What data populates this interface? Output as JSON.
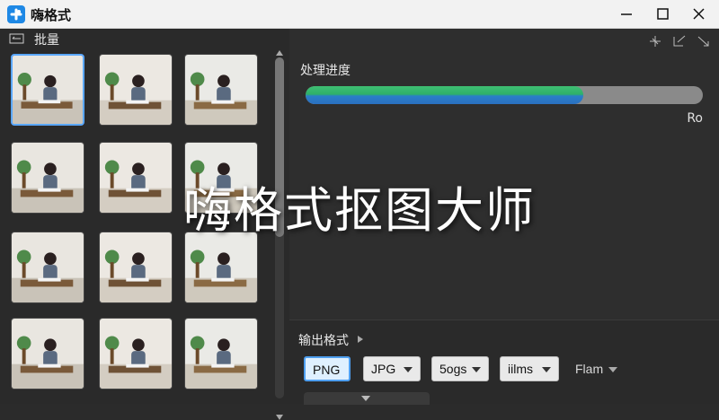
{
  "window": {
    "title": "嗨格式"
  },
  "left": {
    "batch_label": "批量"
  },
  "thumbnails": [
    {
      "name": "photo-1",
      "selected": true
    },
    {
      "name": "photo-2",
      "selected": false
    },
    {
      "name": "photo-3",
      "selected": false
    },
    {
      "name": "photo-4",
      "selected": false
    },
    {
      "name": "photo-5",
      "selected": false
    },
    {
      "name": "photo-6",
      "selected": false
    },
    {
      "name": "photo-7",
      "selected": false
    },
    {
      "name": "photo-8",
      "selected": false
    },
    {
      "name": "photo-9",
      "selected": false
    },
    {
      "name": "photo-10",
      "selected": false
    },
    {
      "name": "photo-11",
      "selected": false
    },
    {
      "name": "photo-12",
      "selected": false
    }
  ],
  "progress": {
    "label": "处理进度",
    "value_text": "Ro",
    "fraction": 0.7,
    "colors": {
      "top": "#3fbf73",
      "bottom": "#2a6fc0",
      "track": "#8a8a8a"
    }
  },
  "overlay": {
    "title": "嗨格式抠图大师"
  },
  "output": {
    "label": "输出格式",
    "buttons": [
      {
        "label": "PNG",
        "active": true,
        "dropdown": false
      },
      {
        "label": "JPG",
        "active": false,
        "dropdown": true
      },
      {
        "label": "5ogs",
        "active": false,
        "dropdown": true
      },
      {
        "label": "iilms",
        "active": false,
        "dropdown": true
      }
    ],
    "extra": {
      "label": "Flam"
    }
  },
  "icons": [
    "app-logo-icon",
    "minimize-icon",
    "maximize-icon",
    "close-icon",
    "list-icon",
    "crop-icon",
    "expand-icon",
    "collapse-icon"
  ]
}
